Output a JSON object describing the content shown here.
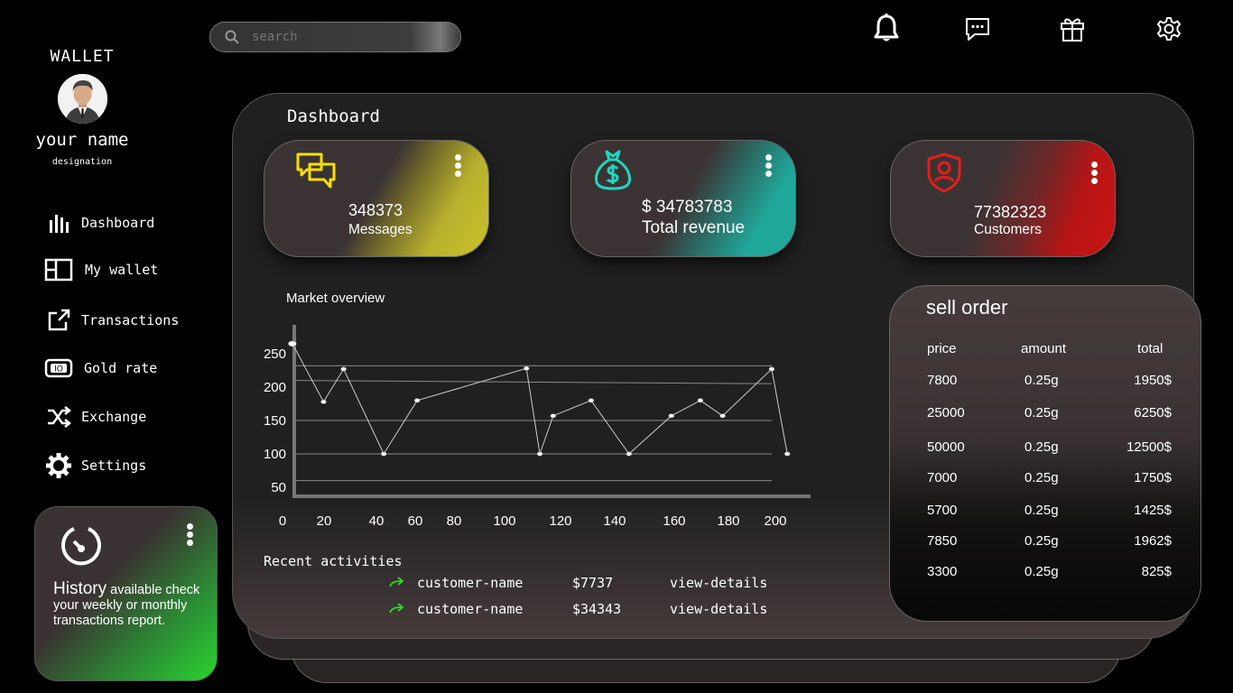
{
  "sidebar": {
    "brand": "WALLET",
    "user_name": "your name",
    "designation": "designation",
    "nav": [
      {
        "label": "Dashboard",
        "icon": "bar-chart-icon"
      },
      {
        "label": "My wallet",
        "icon": "wallet-icon"
      },
      {
        "label": "Transactions",
        "icon": "external-link-icon"
      },
      {
        "label": "Gold rate",
        "icon": "banknote-icon"
      },
      {
        "label": "Exchange",
        "icon": "shuffle-icon"
      },
      {
        "label": "Settings",
        "icon": "gear-icon"
      }
    ],
    "history_card": {
      "title": "History",
      "text_1": " available check",
      "text_2": "your weekly or monthly transactions report.",
      "accent": "#29d42f"
    }
  },
  "search": {
    "placeholder": "search"
  },
  "topbar_icons": [
    "bell-icon",
    "message-icon",
    "gift-icon",
    "settings-icon"
  ],
  "main": {
    "title": "Dashboard",
    "stats": [
      {
        "value": "348373",
        "label": "Messages",
        "icon": "chat-icon",
        "accent": "#c8c22a"
      },
      {
        "value": "$ 34783783",
        "label": "Total revenue",
        "icon": "money-bag-icon",
        "accent": "#1fa89a"
      },
      {
        "value": "77382323",
        "label": "Customers",
        "icon": "shield-user-icon",
        "accent": "#c81414"
      }
    ],
    "market_title": "Market overview",
    "recent_title": "Recent activities",
    "activities": [
      {
        "name": "customer-name",
        "amount": "$7737",
        "link": "view-details"
      },
      {
        "name": "customer-name",
        "amount": "$34343",
        "link": "view-details"
      }
    ]
  },
  "chart_data": {
    "type": "line",
    "title": "Market overview",
    "xticks": [
      0,
      20,
      40,
      60,
      80,
      100,
      120,
      140,
      160,
      180,
      200
    ],
    "yticks": [
      50,
      100,
      150,
      200,
      250
    ],
    "x": [
      4,
      18,
      27,
      45,
      60,
      109,
      115,
      121,
      138,
      155,
      174,
      187,
      197,
      219,
      226
    ],
    "y": [
      265,
      178,
      227,
      100,
      180,
      228,
      100,
      157,
      180,
      100,
      157,
      180,
      157,
      227,
      100
    ]
  },
  "sell_order": {
    "title": "sell order",
    "headers": [
      "price",
      "amount",
      "total"
    ],
    "rows": [
      [
        "7800",
        "0.25g",
        "1950$"
      ],
      [
        "25000",
        "0.25g",
        "6250$"
      ],
      [
        "50000",
        "0.25g",
        "12500$"
      ],
      [
        "7000",
        "0.25g",
        "1750$"
      ],
      [
        "5700",
        "0.25g",
        "1425$"
      ],
      [
        "7850",
        "0.25g",
        "1962$"
      ],
      [
        "3300",
        "0.25g",
        "825$"
      ]
    ]
  }
}
